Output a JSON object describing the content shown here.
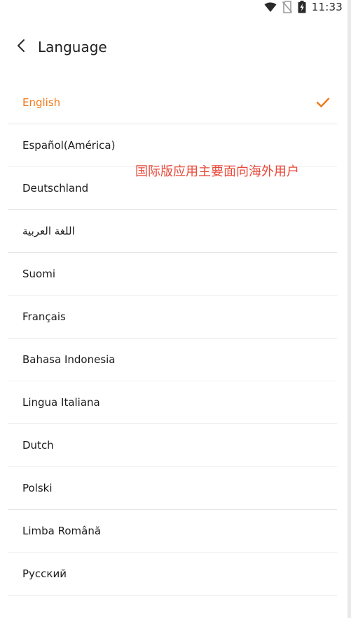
{
  "status_bar": {
    "time": "11:33",
    "icons": [
      "wifi-icon",
      "no-sim-icon",
      "battery-charging-icon"
    ]
  },
  "header": {
    "title": "Language",
    "back_icon": "chevron-left-icon"
  },
  "annotation": {
    "text": "国际版应用主要面向海外用户"
  },
  "languages": [
    {
      "label": "English",
      "selected": true
    },
    {
      "label": "Español(América)",
      "selected": false
    },
    {
      "label": "Deutschland",
      "selected": false
    },
    {
      "label": "اللغة العربية",
      "selected": false
    },
    {
      "label": "Suomi",
      "selected": false
    },
    {
      "label": "Français",
      "selected": false
    },
    {
      "label": "Bahasa Indonesia",
      "selected": false
    },
    {
      "label": "Lingua Italiana",
      "selected": false
    },
    {
      "label": "Dutch",
      "selected": false
    },
    {
      "label": "Polski",
      "selected": false
    },
    {
      "label": "Limba Română",
      "selected": false
    },
    {
      "label": "Русский",
      "selected": false
    }
  ],
  "colors": {
    "accent": "#f07a1a",
    "annotation": "#e84a3a",
    "divider": "#e6e6e6",
    "text": "#1c1c1c"
  }
}
